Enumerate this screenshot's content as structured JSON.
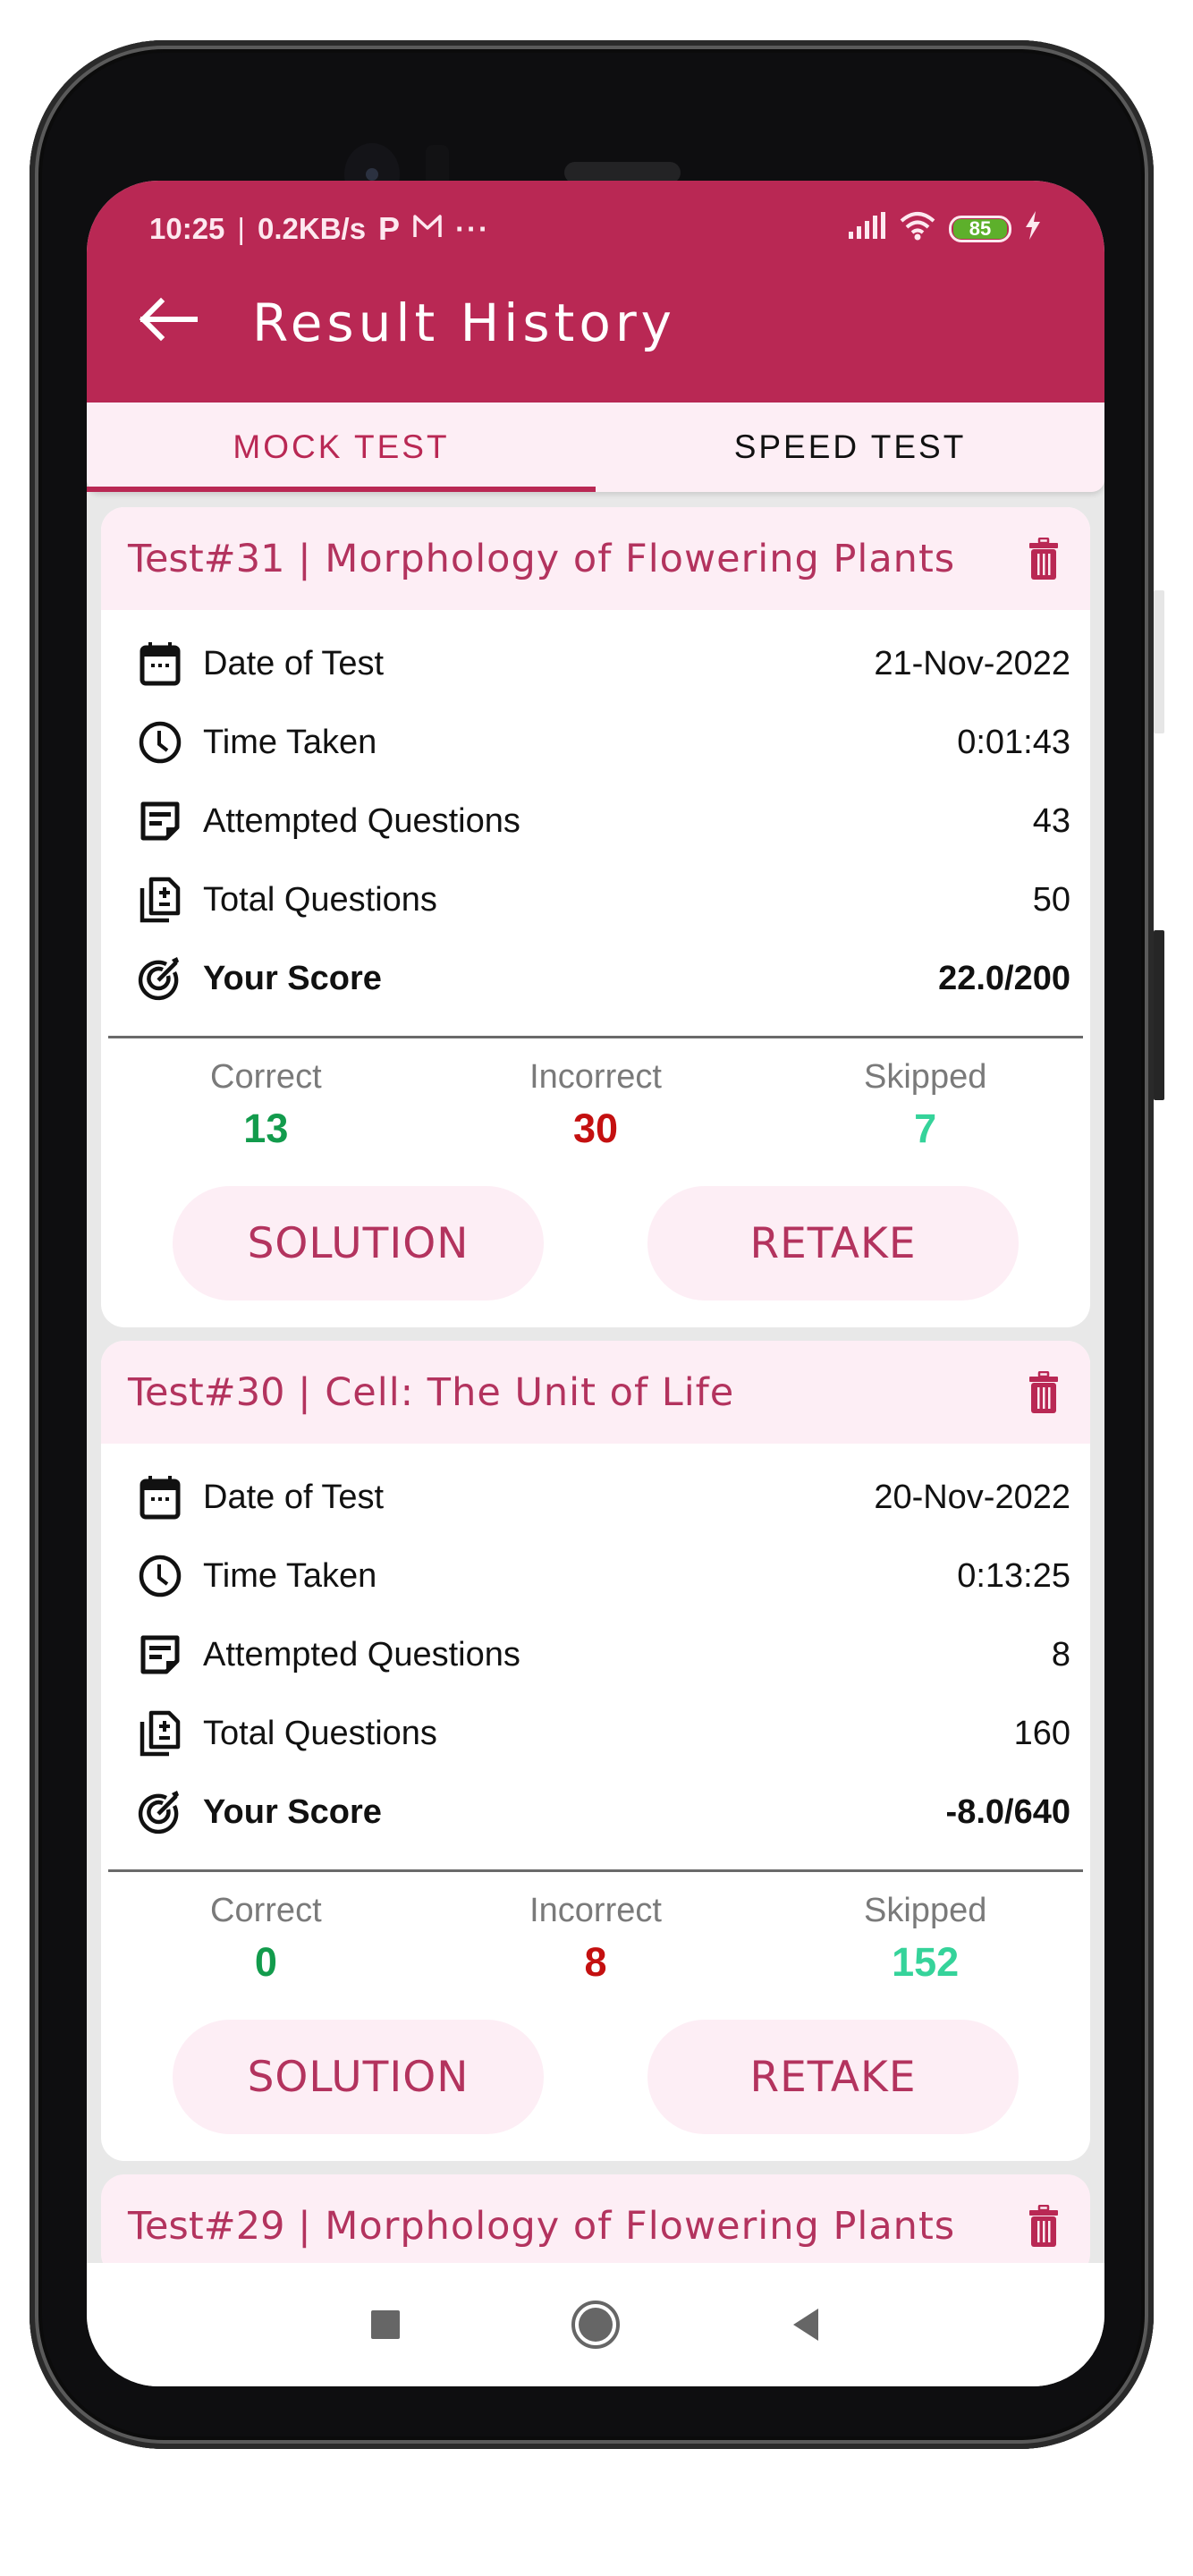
{
  "status_bar": {
    "time": "10:25",
    "net_speed": "0.2KB/s",
    "notification_icons": [
      "p-icon",
      "gmail-icon",
      "more-dots-icon"
    ],
    "battery_level": "85",
    "charging": true
  },
  "app_bar": {
    "title": "Result History",
    "back_icon": "arrow-left-icon"
  },
  "tabs": [
    {
      "label": "MOCK TEST",
      "active": true
    },
    {
      "label": "SPEED TEST",
      "active": false
    }
  ],
  "labels": {
    "date": "Date of Test",
    "time": "Time Taken",
    "attempted": "Attempted Questions",
    "total": "Total Questions",
    "score": "Your Score",
    "correct": "Correct",
    "incorrect": "Incorrect",
    "skipped": "Skipped",
    "solution": "SOLUTION",
    "retake": "RETAKE"
  },
  "tests": [
    {
      "number": "Test#31",
      "separator": "|",
      "topic": "Morphology of Flowering Plants",
      "date": "21-Nov-2022",
      "time_taken": "0:01:43",
      "attempted": "43",
      "total": "50",
      "score": "22.0/200",
      "correct": "13",
      "incorrect": "30",
      "skipped": "7"
    },
    {
      "number": "Test#30",
      "separator": "|",
      "topic": "Cell: The Unit of Life",
      "date": "20-Nov-2022",
      "time_taken": "0:13:25",
      "attempted": "8",
      "total": "160",
      "score": "-8.0/640",
      "correct": "0",
      "incorrect": "8",
      "skipped": "152"
    },
    {
      "number": "Test#29",
      "separator": "|",
      "topic": "Morphology of Flowering Plants"
    }
  ],
  "colors": {
    "primary": "#b92854",
    "tint": "#fdeef5",
    "correct": "#129b4c",
    "incorrect": "#c41010",
    "skipped": "#35d39a"
  }
}
